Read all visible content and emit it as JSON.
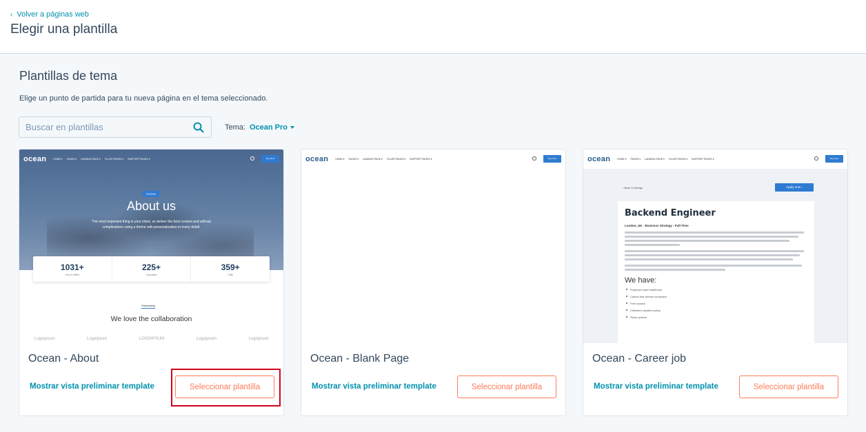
{
  "header": {
    "back_label": "Volver a páginas web",
    "title": "Elegir una plantilla"
  },
  "section": {
    "title": "Plantillas de tema",
    "description": "Elige un punto de partida para tu nueva página en el tema seleccionado."
  },
  "search": {
    "placeholder": "Buscar en plantillas"
  },
  "theme": {
    "label": "Tema:",
    "value": "Ocean Pro"
  },
  "cards": [
    {
      "title": "Ocean - About",
      "preview_label": "Mostrar vista preliminar template",
      "select_label": "Seleccionar plantilla",
      "highlighted": true
    },
    {
      "title": "Ocean - Blank Page",
      "preview_label": "Mostrar vista preliminar template",
      "select_label": "Seleccionar plantilla",
      "highlighted": false
    },
    {
      "title": "Ocean - Career job",
      "preview_label": "Mostrar vista preliminar template",
      "select_label": "Seleccionar plantilla",
      "highlighted": false
    }
  ],
  "mini_site": {
    "logo": "ocean",
    "menu": [
      "HOME ▾",
      "PAGES ▾",
      "LANDING PAGE ▾",
      "FILLER PAGES ▾",
      "SUPPORT PAGES ▾"
    ],
    "cta": "Buy Now"
  },
  "about_preview": {
    "badge": "OCEAN",
    "title": "About us",
    "subtitle": "The most important thing is your client, so deliver the best content and without complications using a theme with personalization in every detail.",
    "stats": [
      {
        "value": "1031+",
        "label": "Cup of coffee"
      },
      {
        "value": "225+",
        "label": "Cupcakes"
      },
      {
        "value": "359+",
        "label": "Calls"
      }
    ],
    "feature_tag": "Partnership",
    "feature_title": "We love the collaboration",
    "logos": [
      "Logoipsum",
      "Logoipsum",
      "LOGOIPSUM",
      "Logoipsum",
      "Logoipsum"
    ]
  },
  "career_preview": {
    "back": "‹ Back to listings",
    "apply": "Apply now  ›",
    "job_title": "Backend Engineer",
    "meta": "London, UK - Business Strategy - Full-Time",
    "we_have": "We have:",
    "bullets": [
      "Employee paid healthcare",
      "Casual and diverse workplace",
      "Free snacks",
      "Unlimited vacation policy",
      "Stock options"
    ]
  },
  "colors": {
    "accent_link": "#0091ae",
    "button_orange": "#ff7a59",
    "highlight_red": "#d0021b",
    "text_primary": "#33475b"
  }
}
